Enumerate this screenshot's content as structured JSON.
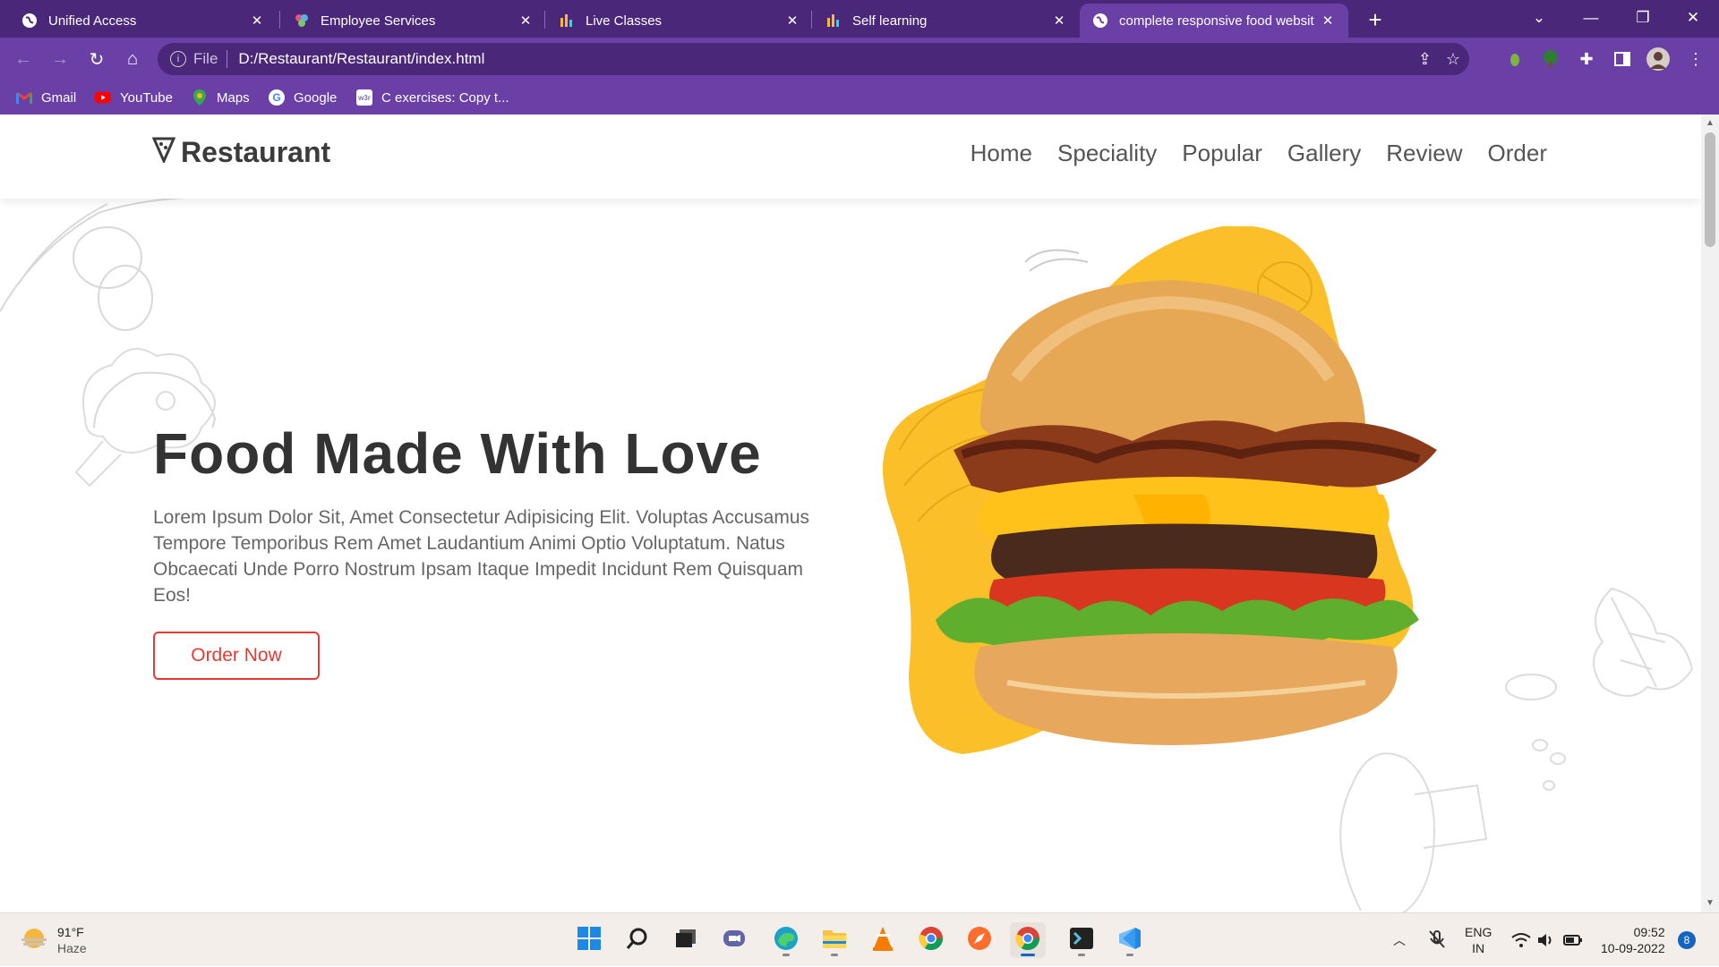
{
  "browser": {
    "tabs": [
      {
        "title": "Unified Access",
        "favicon": "globe-icon"
      },
      {
        "title": "Employee Services",
        "favicon": "employee-services-icon"
      },
      {
        "title": "Live Classes",
        "favicon": "bar-chart-icon"
      },
      {
        "title": "Self learning",
        "favicon": "bar-chart-icon"
      },
      {
        "title": "complete responsive food websit",
        "favicon": "globe-icon",
        "active": true
      }
    ],
    "address": {
      "scheme": "File",
      "url": "D:/Restaurant/Restaurant/index.html"
    },
    "bookmarks": [
      {
        "label": "Gmail",
        "icon": "gmail-icon"
      },
      {
        "label": "YouTube",
        "icon": "youtube-icon"
      },
      {
        "label": "Maps",
        "icon": "maps-icon"
      },
      {
        "label": "Google",
        "icon": "google-icon"
      },
      {
        "label": "C exercises: Copy t...",
        "icon": "w3resource-icon"
      }
    ],
    "theme": {
      "frame": "#4b2779",
      "toolbar": "#6a3fa6"
    }
  },
  "site": {
    "logo": "Restaurant",
    "nav": [
      "Home",
      "Speciality",
      "Popular",
      "Gallery",
      "Review",
      "Order"
    ],
    "hero": {
      "title": "Food Made With Love",
      "text": "Lorem Ipsum Dolor Sit, Amet Consectetur Adipisicing Elit. Voluptas Accusamus Tempore Temporibus Rem Amet Laudantium Animi Optio Voluptatum. Natus Obcaecati Unde Porro Nostrum Ipsam Itaque Impedit Incidunt Rem Quisquam Eos!",
      "button": "Order Now"
    },
    "colors": {
      "accent": "#e53935",
      "blob": "#fbbf2a",
      "text": "#333333"
    }
  },
  "taskbar": {
    "weather": {
      "temp": "91°F",
      "condition": "Haze"
    },
    "language": {
      "line1": "ENG",
      "line2": "IN"
    },
    "time": "09:52",
    "date": "10-09-2022",
    "notifications": "8"
  }
}
